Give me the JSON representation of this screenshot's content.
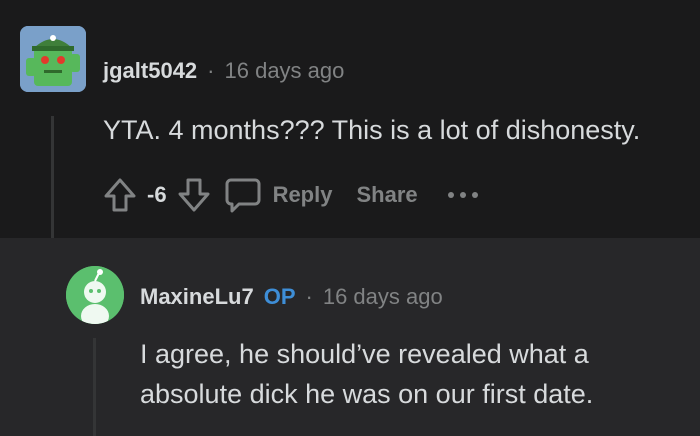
{
  "comment": {
    "username": "jgalt5042",
    "separator": "·",
    "time": "16 days ago",
    "body": "YTA. 4 months??? This is a lot of dishonesty.",
    "score": "-6",
    "reply_label": "Reply",
    "share_label": "Share",
    "icons": [
      "upvote-icon",
      "downvote-icon",
      "comment-icon",
      "more-icon"
    ]
  },
  "reply": {
    "username": "MaxineLu7",
    "op_badge": "OP",
    "separator": "·",
    "time": "16 days ago",
    "body_line1": "I agree, he should’ve revealed what a",
    "body_line2": "absolute dick he was on our first date."
  },
  "colors": {
    "background": "#1a1a1b",
    "reply_background": "#272729",
    "text": "#d7dadc",
    "muted": "#818384",
    "op_blue": "#3e8ed7",
    "avatar_green": "#5bbf6e"
  }
}
